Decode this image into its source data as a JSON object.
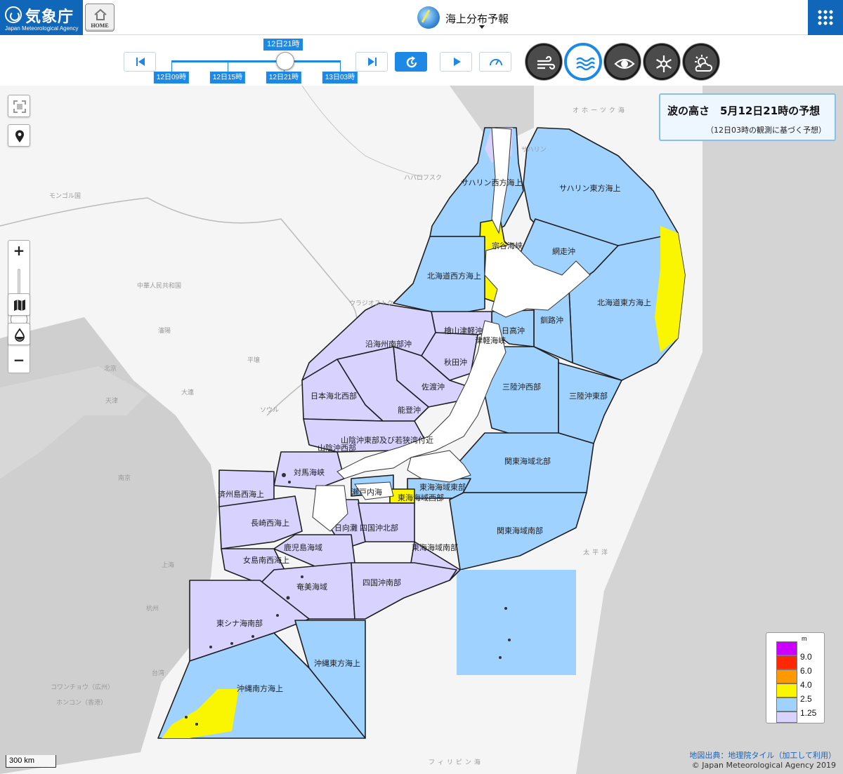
{
  "header": {
    "agency_name": "気象庁",
    "agency_name_en": "Japan Meteorological Agency",
    "home_label": "HOME",
    "title": "海上分布予報"
  },
  "timeline": {
    "current": "12日21時",
    "ticks": [
      "12日09時",
      "12日15時",
      "12日21時",
      "13日03時"
    ]
  },
  "map": {
    "info_title": "波の高さ　5月12日21時の予想",
    "info_sub": "（12日03時の観測に基づく予想）",
    "areas": [
      "サハリン西方海上",
      "サハリン東方海上",
      "宗谷海峡",
      "網走沖",
      "北海道西方海上",
      "北海道東方海上",
      "檜山津軽沖",
      "日高沖",
      "津軽海峡",
      "釧路沖",
      "沿海州南部沖",
      "秋田沖",
      "佐渡沖",
      "三陸沖西部",
      "三陸沖東部",
      "日本海北西部",
      "能登沖",
      "山陰沖東部及び若狭湾付近",
      "山陰沖西部",
      "関東海域北部",
      "対馬海峡",
      "済州島西海上",
      "瀬戸内海",
      "東海海域東部",
      "東海海域西部",
      "長崎西海上",
      "日向灘",
      "四国沖北部",
      "関東海域南部",
      "鹿児島海域",
      "東海海域南部",
      "女島南西海上",
      "奄美海域",
      "四国沖南部",
      "東シナ海南部",
      "沖縄東方海上",
      "沖縄南方海上"
    ],
    "sea_names": [
      "オホーツク海",
      "太平洋",
      "フィリピン海"
    ],
    "place_names": [
      "サハリン",
      "ハバロフスク",
      "モンゴル国",
      "中華人民共和国",
      "ウラジオストク",
      "瀋陽",
      "北京",
      "天津",
      "大連",
      "上海",
      "南京",
      "杭州",
      "コワンチョウ（広州）",
      "ホンコン（香港）",
      "ソウル",
      "平壌",
      "台湾"
    ],
    "legend": {
      "unit": "m",
      "items": [
        {
          "label": "9.0",
          "color": "#cc00ff"
        },
        {
          "label": "6.0",
          "color": "#ff2800"
        },
        {
          "label": "4.0",
          "color": "#ff9900"
        },
        {
          "label": "2.5",
          "color": "#faf500"
        },
        {
          "label": "1.25",
          "color": "#a0d2ff"
        },
        {
          "label": "",
          "color": "#d7d2ff"
        }
      ]
    },
    "scale": "300 km",
    "credit_source": "地図出典：地理院タイル（加工して利用）",
    "copyright": "© Japan Meteorological Agency 2019"
  }
}
